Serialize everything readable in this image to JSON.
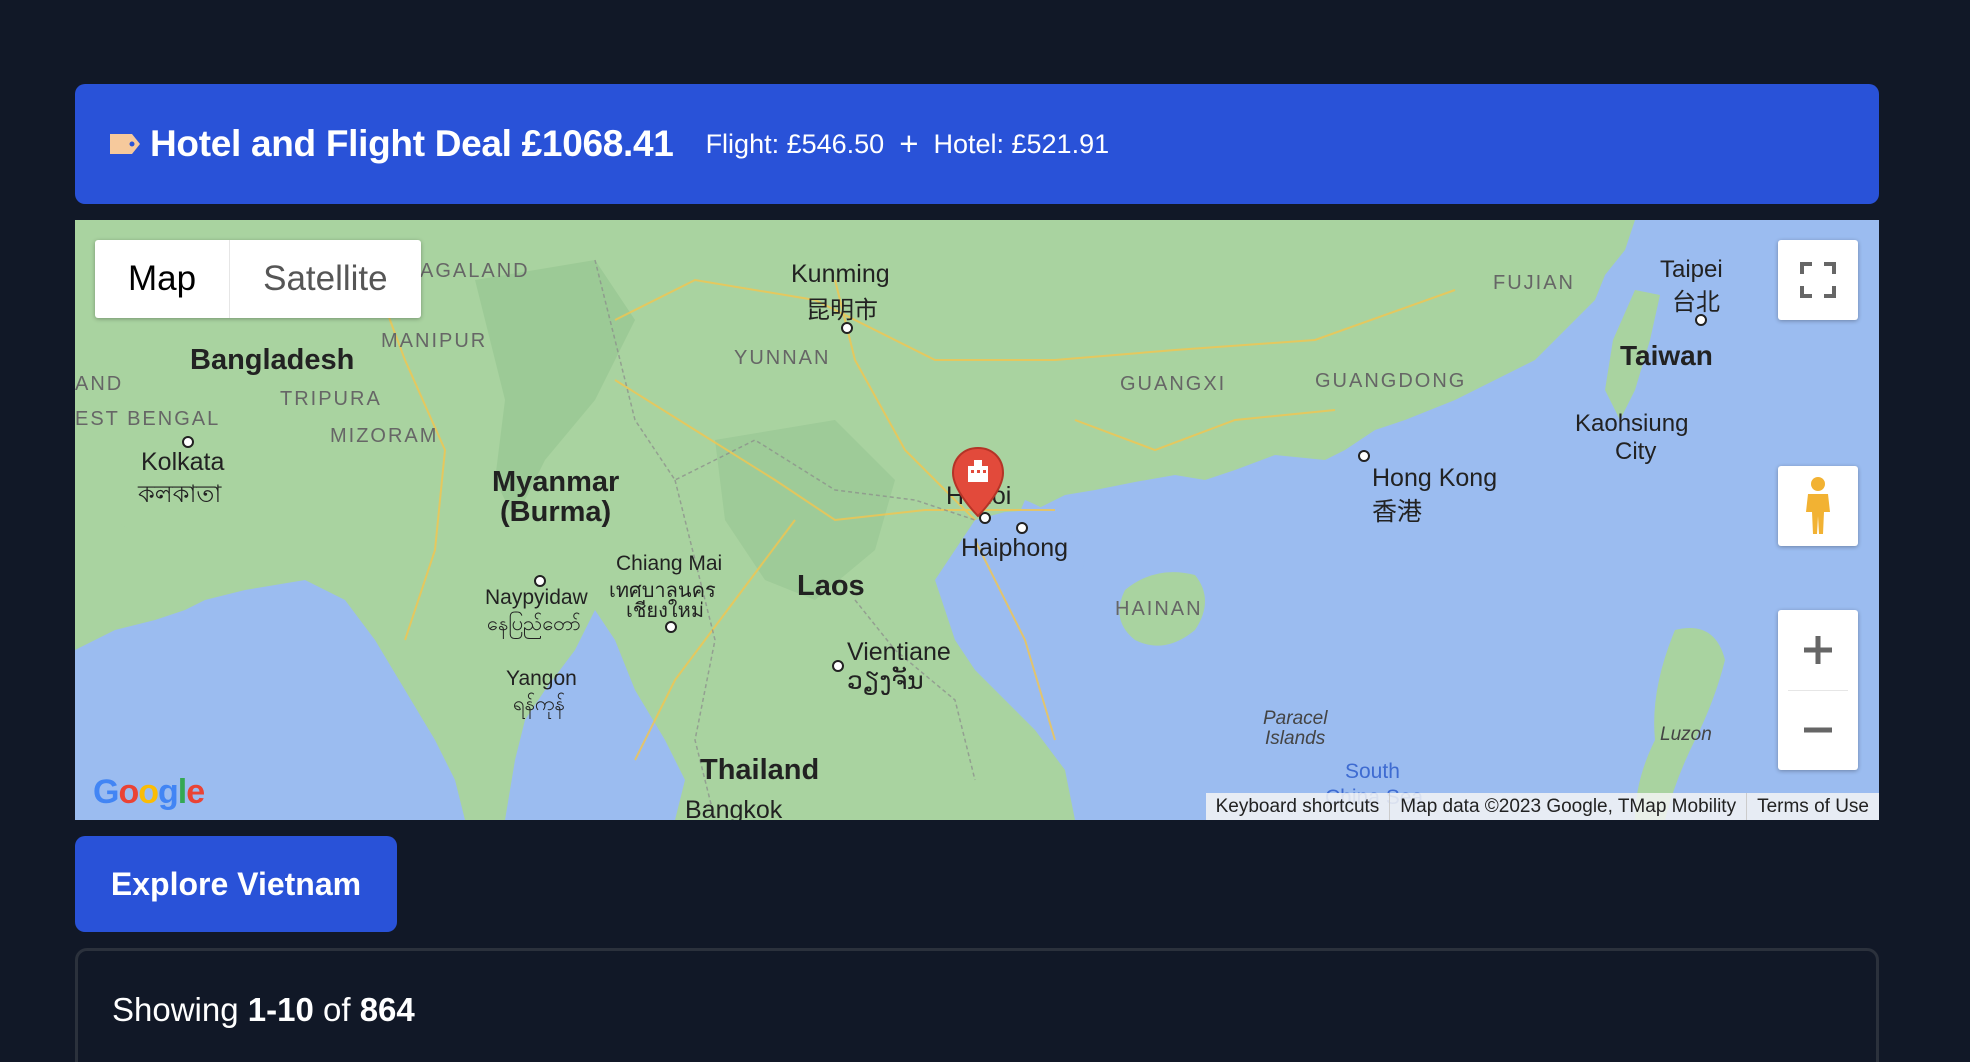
{
  "deal": {
    "icon": "tag-icon",
    "title": "Hotel and Flight Deal £1068.41",
    "flight": "Flight: £546.50",
    "plus": "+",
    "hotel": "Hotel: £521.91"
  },
  "map": {
    "type_controls": {
      "map": "Map",
      "satellite": "Satellite"
    },
    "selected_type": "Map",
    "marker_icon": "hotel-marker-icon",
    "logo": "Google",
    "attribution": {
      "shortcuts": "Keyboard shortcuts",
      "data": "Map data ©2023 Google, TMap Mobility",
      "terms": "Terms of Use"
    },
    "labels": {
      "kunming": "Kunming",
      "kunming_local": "昆明市",
      "taipei": "Taipei",
      "taipei_local": "台北",
      "taiwan": "Taiwan",
      "kaohsiung": "Kaohsiung",
      "city": "City",
      "fujian": "FUJIAN",
      "guangxi": "GUANGXI",
      "guangdong": "GUANGDONG",
      "yunnan": "YUNNAN",
      "manipur": "MANIPUR",
      "nagaland": "AGALAND",
      "tripura": "TRIPURA",
      "mizoram": "MIZORAM",
      "west_bengal": "EST BENGAL",
      "and": "AND",
      "bangladesh": "Bangladesh",
      "kolkata": "Kolkata",
      "kolkata_local": "কলকাতা",
      "myanmar": "Myanmar",
      "burma": "(Burma)",
      "chiang_mai": "Chiang Mai",
      "chiang_mai_th1": "เทศบาลนคร",
      "chiang_mai_th2": "เชียงใหม่",
      "naypyidaw": "Naypyidaw",
      "naypyidaw_local": "နေပြည်တော်",
      "yangon": "Yangon",
      "yangon_local": "ရန်ကုန်",
      "laos": "Laos",
      "vientiane": "Vientiane",
      "vientiane_local": "ວຽງຈັນ",
      "thailand": "Thailand",
      "bangkok": "Bangkok",
      "hanoi": "Hanoi",
      "haiphong": "Haiphong",
      "hong_kong": "Hong Kong",
      "hong_kong_local": "香港",
      "hainan": "HAINAN",
      "paracel": "Paracel",
      "islands": "Islands",
      "south": "South",
      "china_sea": "China Sea",
      "luzon": "Luzon"
    }
  },
  "explore_button": "Explore Vietnam",
  "results": {
    "prefix": "Showing ",
    "range": "1-10",
    "of": " of ",
    "total": "864"
  }
}
